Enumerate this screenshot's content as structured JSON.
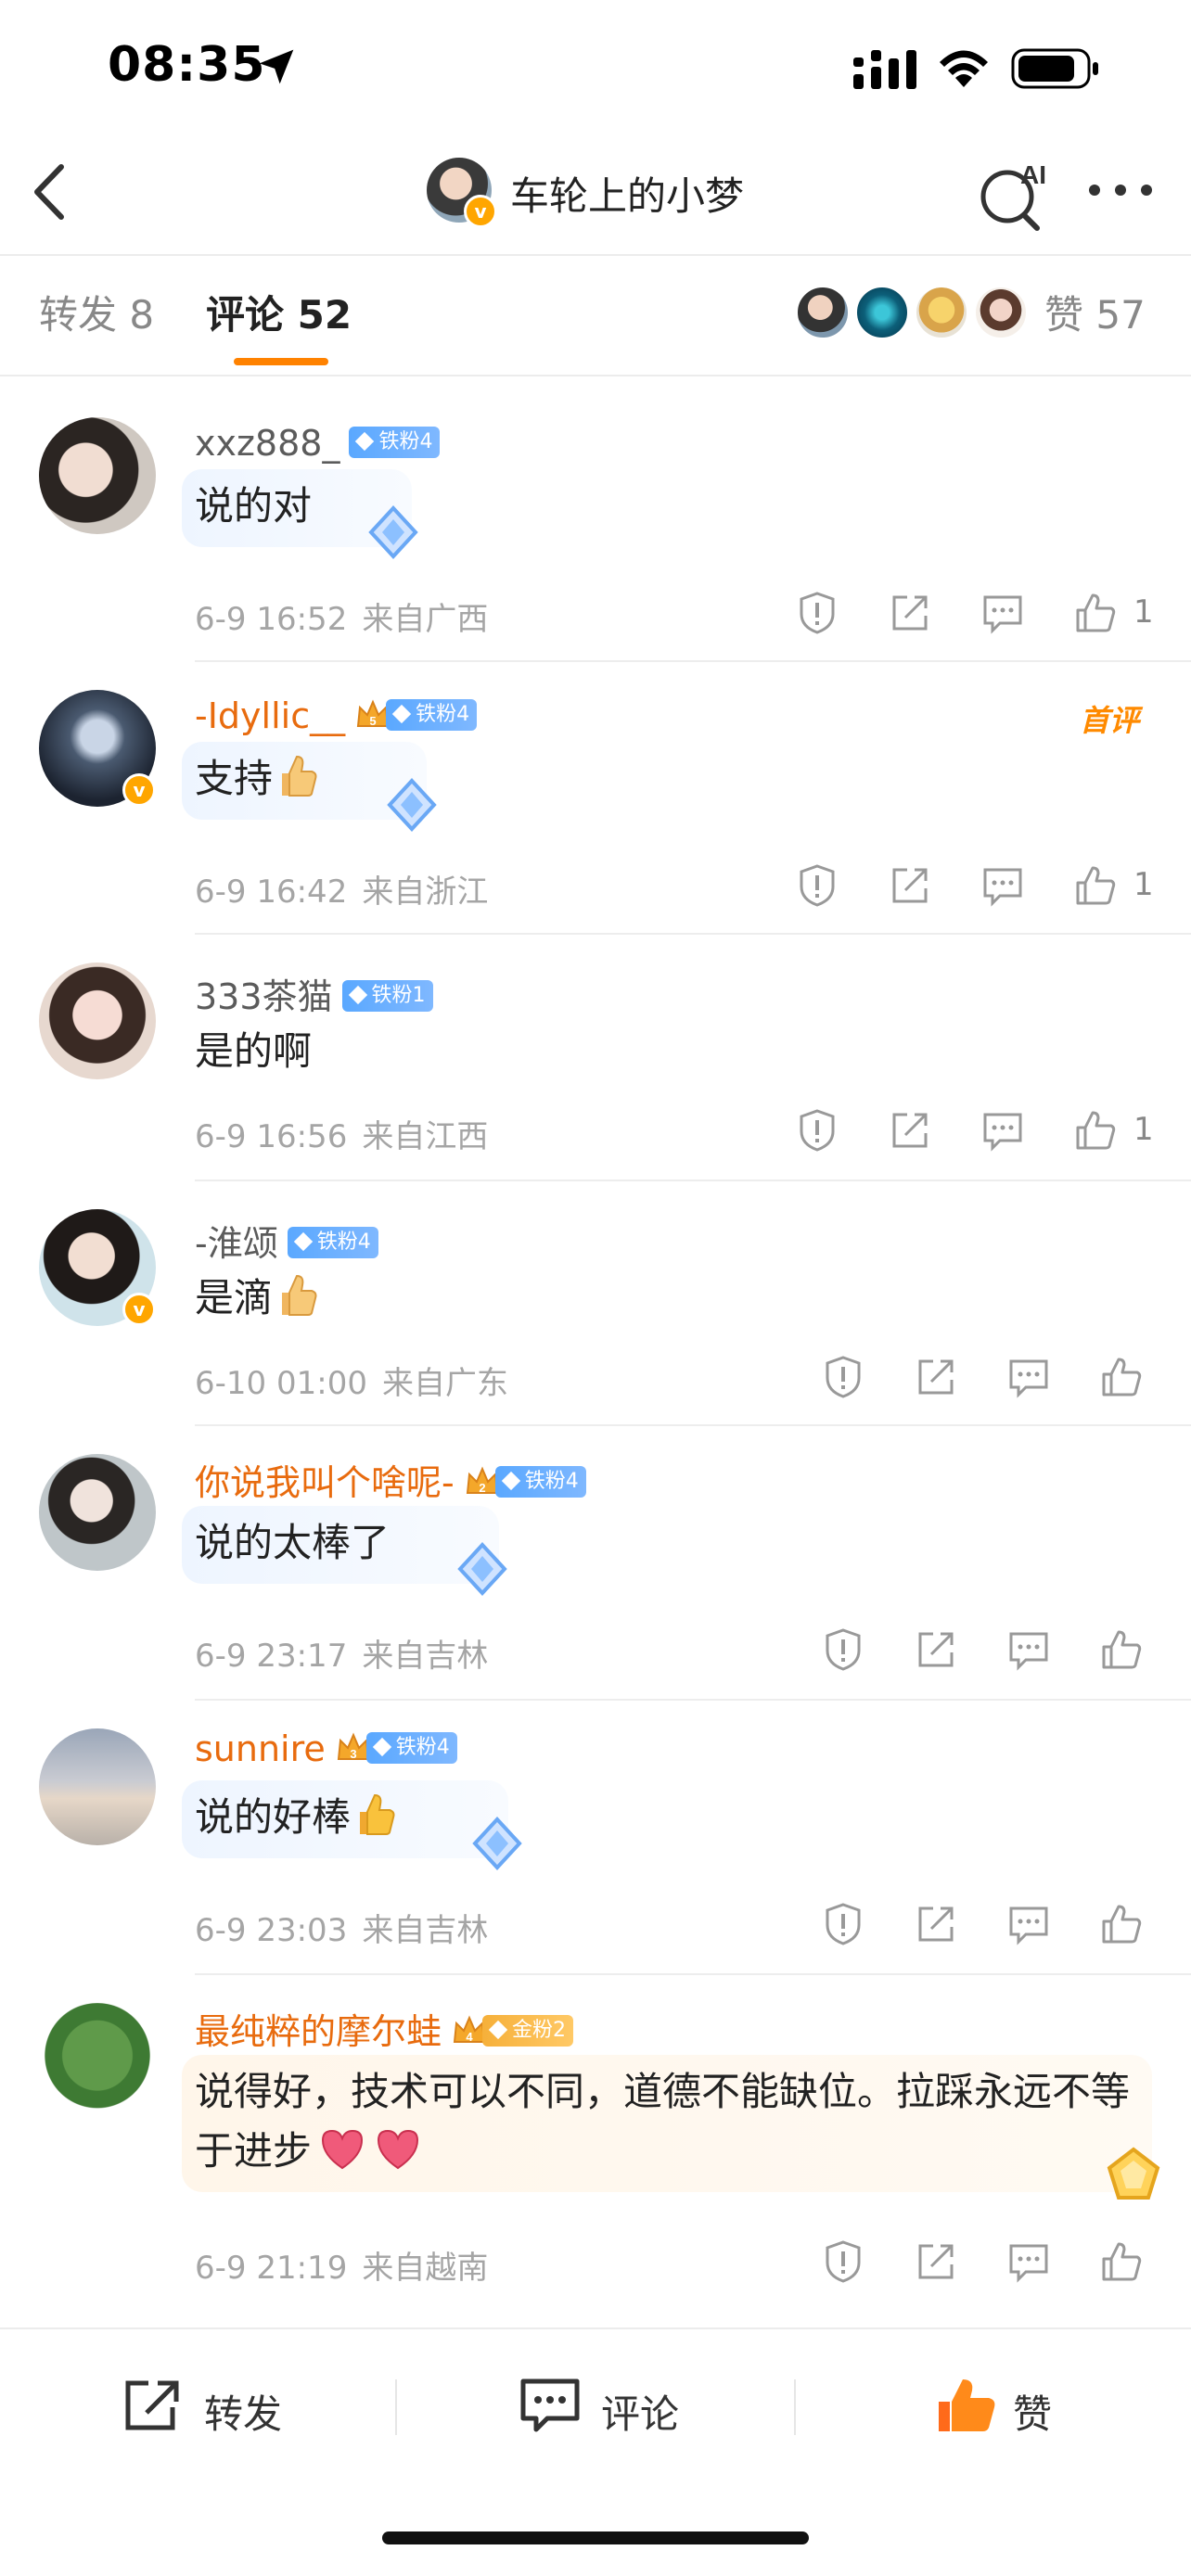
{
  "status_bar": {
    "time": "08:35"
  },
  "header": {
    "title": "车轮上的小梦",
    "ai_label": "AI"
  },
  "tabs": [
    {
      "label": "转发 8"
    },
    {
      "label": "评论 52"
    }
  ],
  "likes": {
    "label": "赞 57"
  },
  "comments": [
    {
      "username": "xxz888_",
      "badge": "铁粉4",
      "text": "说的对",
      "date": "6-9 16:52",
      "location": "来自广西",
      "likes": "1"
    },
    {
      "username": "-Idyllic__",
      "badge": "铁粉4",
      "crown_level": "5",
      "text": "支持",
      "date": "6-9 16:42",
      "location": "来自浙江",
      "likes": "1",
      "tag": "首评"
    },
    {
      "username": "333茶猫",
      "badge": "铁粉1",
      "text": "是的啊",
      "date": "6-9 16:56",
      "location": "来自江西",
      "likes": "1"
    },
    {
      "username": "-淮颂",
      "badge": "铁粉4",
      "text": "是滴",
      "date": "6-10 01:00",
      "location": "来自广东",
      "likes": ""
    },
    {
      "username": "你说我叫个啥呢-",
      "badge": "铁粉4",
      "crown_level": "2",
      "text": "说的太棒了",
      "date": "6-9 23:17",
      "location": "来自吉林",
      "likes": ""
    },
    {
      "username": "sunnire",
      "badge": "铁粉4",
      "crown_level": "3",
      "text": "说的好棒",
      "date": "6-9 23:03",
      "location": "来自吉林",
      "likes": ""
    },
    {
      "username": "最纯粹的摩尔蛙",
      "badge": "金粉2",
      "crown_level": "4",
      "text": "说得好，技术可以不同，道德不能缺位。拉踩永远不等于进步",
      "date": "6-9 21:19",
      "location": "来自越南",
      "likes": ""
    }
  ],
  "bottom_bar": {
    "repost": "转发",
    "comment": "评论",
    "like": "赞"
  },
  "colors": {
    "accent": "#ff8200",
    "vip_name": "#e86b0e",
    "fan_badge": "#5aa8ff",
    "gold_badge": "#f6b03a"
  }
}
